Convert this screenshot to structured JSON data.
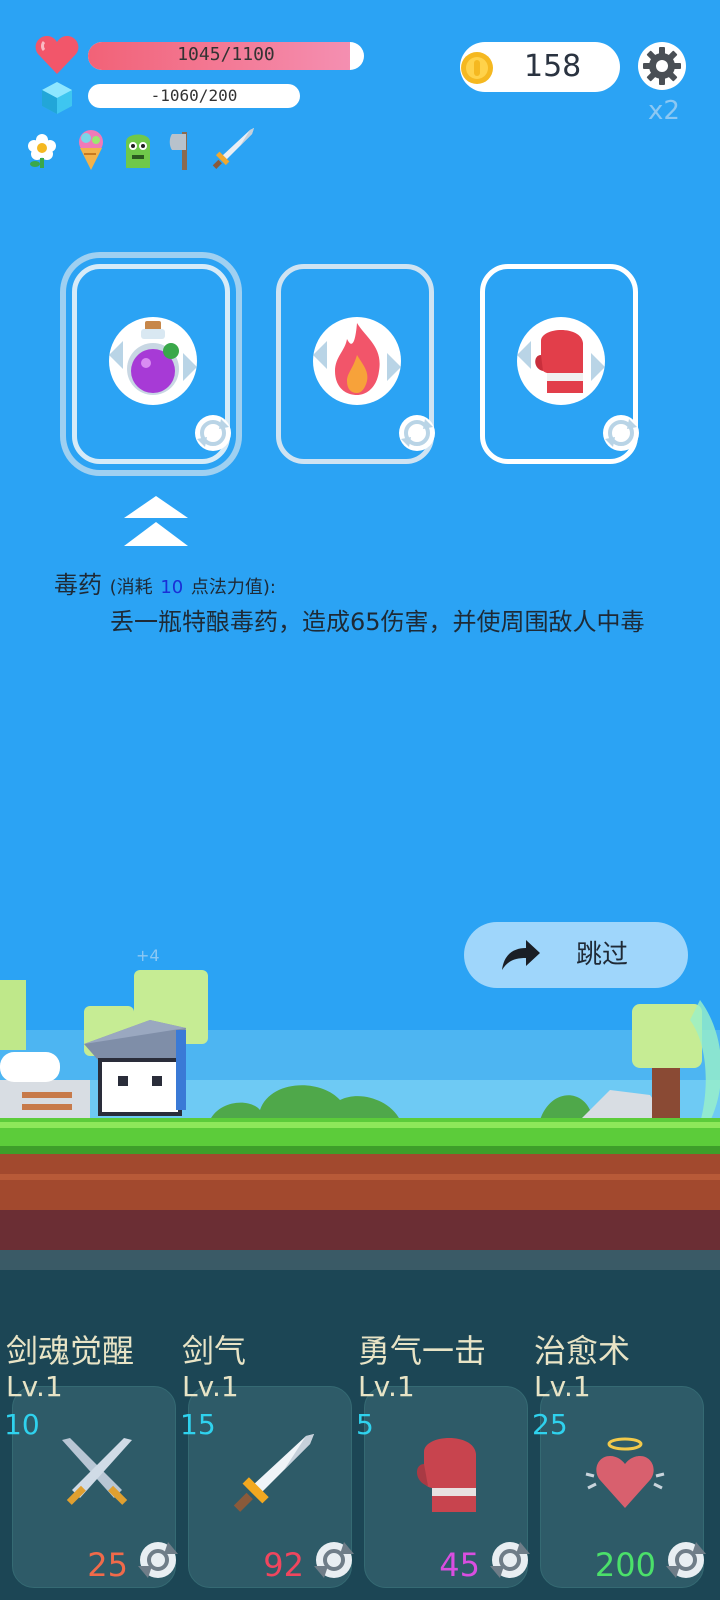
{
  "hud": {
    "hp_text": "1045/1100",
    "hp_fraction": 0.95,
    "mp_text": "-1060/200",
    "mp_fraction": 0,
    "coins": "158",
    "speed": "x2",
    "buff_icons": [
      "flower-icon",
      "ice-cream-icon",
      "green-monster-icon",
      "axe-icon",
      "sword-icon"
    ]
  },
  "cards": [
    {
      "name": "poison-potion",
      "icon": "potion-icon",
      "selected": true
    },
    {
      "name": "fire",
      "icon": "fire-icon",
      "selected": false
    },
    {
      "name": "boxing-glove",
      "icon": "boxing-glove-icon",
      "selected": false
    }
  ],
  "description": {
    "title": "毒药",
    "cost_prefix": "(消耗",
    "cost_value": "10",
    "cost_suffix": "点法力值):",
    "body": "丢一瓶特酿毒药，造成65伤害，并使周围敌人中毒"
  },
  "skip_label": "跳过",
  "floating_text": "+4",
  "skills": [
    {
      "name": "剑魂觉醒",
      "level": "Lv.1",
      "mp": "10",
      "cost": "25",
      "cost_color": "#f06a4a",
      "icon": "crossed-swords-icon"
    },
    {
      "name": "剑气",
      "level": "Lv.1",
      "mp": "15",
      "cost": "92",
      "cost_color": "#f0465e",
      "icon": "sword-icon"
    },
    {
      "name": "勇气一击",
      "level": "Lv.1",
      "mp": "5",
      "cost": "45",
      "cost_color": "#d94ee0",
      "icon": "boxing-glove-icon"
    },
    {
      "name": "治愈术",
      "level": "Lv.1",
      "mp": "25",
      "cost": "200",
      "cost_color": "#4be06a",
      "icon": "angel-heart-icon"
    }
  ],
  "colors": {
    "sky": "#2ba3f4",
    "hp": "#f26b7e",
    "grass": "#5ccc3a",
    "dirt": "#a2492e",
    "panel": "#1c4655"
  }
}
